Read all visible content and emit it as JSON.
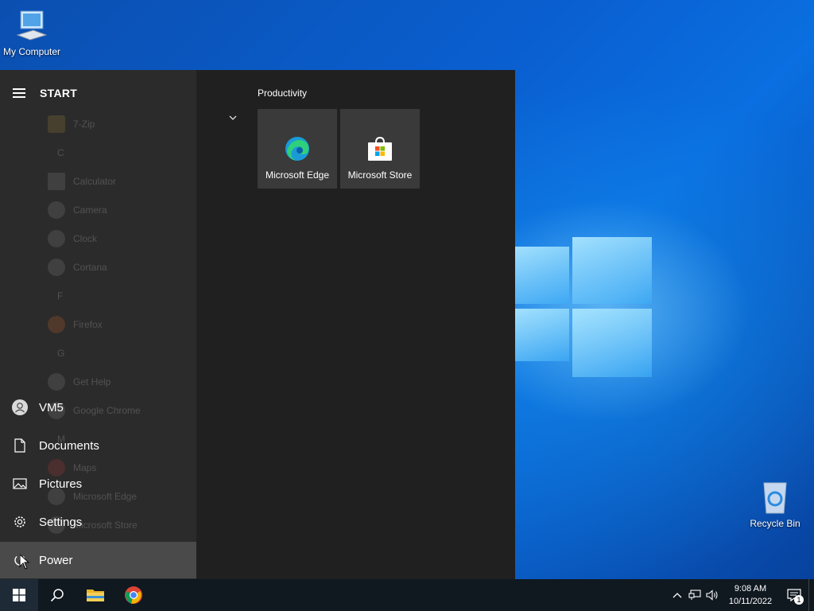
{
  "desktop": {
    "icons": [
      {
        "label": "My Computer",
        "icon": "computer-icon"
      },
      {
        "label": "Recycle Bin",
        "icon": "recycle-bin-icon"
      }
    ]
  },
  "start_menu": {
    "title": "START",
    "app_list": [
      {
        "type": "item",
        "label": "7-Zip"
      },
      {
        "type": "letter",
        "label": "C"
      },
      {
        "type": "item",
        "label": "Calculator"
      },
      {
        "type": "item",
        "label": "Camera"
      },
      {
        "type": "item",
        "label": "Clock"
      },
      {
        "type": "item",
        "label": "Cortana"
      },
      {
        "type": "letter",
        "label": "F"
      },
      {
        "type": "item",
        "label": "Firefox"
      },
      {
        "type": "letter",
        "label": "G"
      },
      {
        "type": "item",
        "label": "Get Help"
      },
      {
        "type": "item",
        "label": "Google Chrome"
      },
      {
        "type": "letter",
        "label": "M"
      },
      {
        "type": "item",
        "label": "Maps"
      },
      {
        "type": "item",
        "label": "Microsoft Edge"
      },
      {
        "type": "item",
        "label": "Microsoft Store"
      }
    ],
    "side_items": [
      {
        "label": "VM5",
        "icon": "user-avatar-icon"
      },
      {
        "label": "Documents",
        "icon": "document-icon"
      },
      {
        "label": "Pictures",
        "icon": "pictures-icon"
      },
      {
        "label": "Settings",
        "icon": "gear-icon"
      },
      {
        "label": "Power",
        "icon": "power-icon"
      }
    ],
    "tile_group": {
      "label": "Productivity",
      "tiles": [
        {
          "label": "Microsoft Edge",
          "icon": "edge-icon"
        },
        {
          "label": "Microsoft Store",
          "icon": "store-icon"
        }
      ]
    }
  },
  "taskbar": {
    "time": "9:08 AM",
    "date": "10/11/2022",
    "notification_count": "1"
  }
}
